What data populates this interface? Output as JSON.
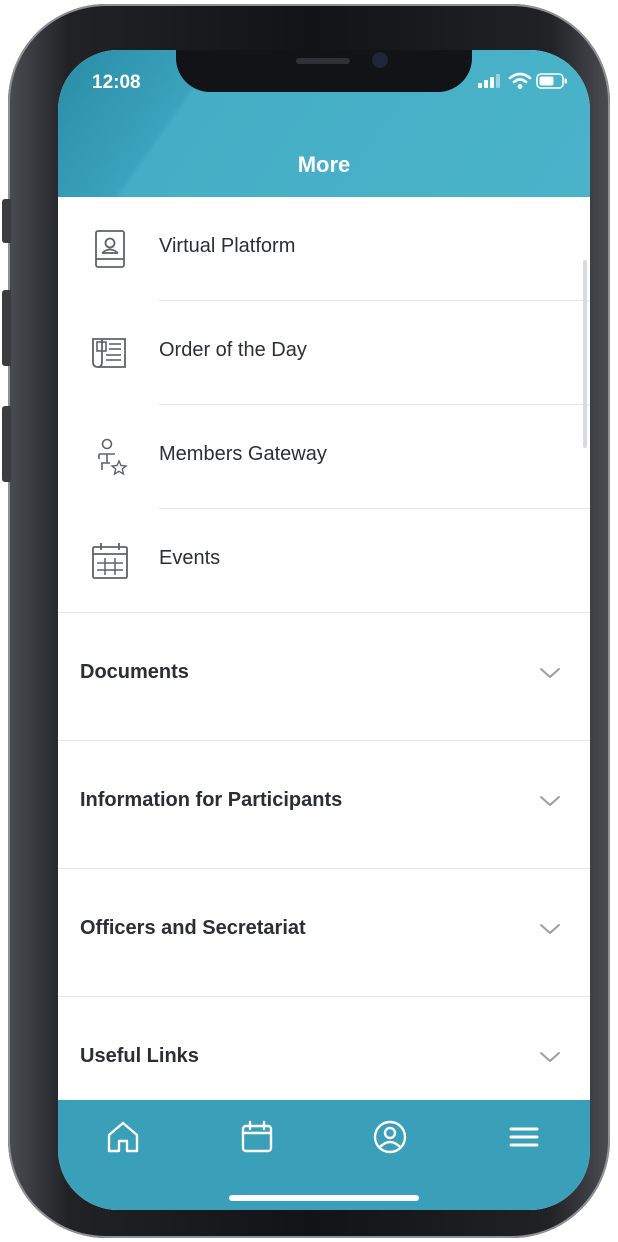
{
  "status_bar": {
    "time": "12:08"
  },
  "header": {
    "title": "More"
  },
  "menu_items": [
    {
      "label": "Virtual Platform",
      "icon": "id-badge-icon"
    },
    {
      "label": "Order of the Day",
      "icon": "newspaper-icon"
    },
    {
      "label": "Members Gateway",
      "icon": "member-star-icon"
    },
    {
      "label": "Events",
      "icon": "calendar-grid-icon"
    }
  ],
  "sections": [
    {
      "label": "Documents"
    },
    {
      "label": "Information for Participants"
    },
    {
      "label": "Officers and Secretariat"
    },
    {
      "label": "Useful Links"
    }
  ],
  "tab_bar": {
    "tabs": [
      {
        "name": "home",
        "icon": "home-icon"
      },
      {
        "name": "calendar",
        "icon": "calendar-icon"
      },
      {
        "name": "profile",
        "icon": "user-circle-icon"
      },
      {
        "name": "more",
        "icon": "hamburger-menu-icon",
        "active": true
      }
    ]
  },
  "colors": {
    "header": "#4ab3ca",
    "tab_bar": "#3a9fb9",
    "text": "#2c2f33",
    "icon": "#5f6368"
  }
}
